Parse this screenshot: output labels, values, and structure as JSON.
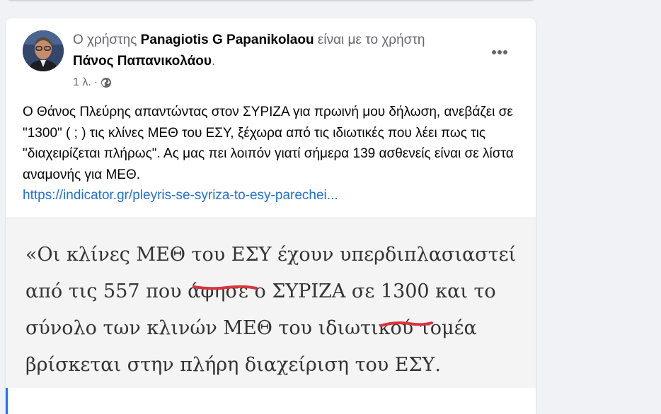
{
  "post": {
    "header": {
      "prefix": "Ο χρήστης ",
      "author": "Panagiotis G Papanikolaou",
      "middle": " είναι με το χρήστη ",
      "tagged": "Πάνος Παπανικολάου",
      "suffix": "."
    },
    "meta": {
      "time": "1 λ.",
      "separator": "·",
      "privacy_icon": "globe-icon"
    },
    "more_icon": "more-options-icon",
    "text": "Ο Θάνος Πλεύρης απαντώντας στον ΣΥΡΙΖΑ για πρωινή μου δήλωση, ανεβάζει σε \"1300\" ( ; ) τις κλίνες ΜΕΘ του ΕΣΥ, ξέχωρα από τις ιδιωτικές που λέει πως τις \"διαχειρίζεται πλήρως\". Ας μας πει λοιπόν γιατί σήμερα 139 ασθενείς είναι σε λίστα αναμονής για ΜΕΘ.",
    "link": "https://indicator.gr/pleyris-se-syriza-to-esy-parechei...",
    "image_quote": {
      "line1": "«Οι κλίνες ΜΕΘ του ΕΣΥ έχουν υπερδιπλασιαστεί",
      "line2": "από τις 557 που άφησε ο ΣΥΡΙΖΑ σε 1300 και το",
      "line3": "σύνολο των κλινών ΜΕΘ του ιδιωτικού τομέα",
      "line4": "βρίσκεται στην πλήρη διαχείριση του ΕΣΥ."
    }
  },
  "colors": {
    "background": "#f0f2f5",
    "card": "#ffffff",
    "secondary_text": "#65676b",
    "link": "#216fdb",
    "underline_marks": "#d9343f"
  }
}
